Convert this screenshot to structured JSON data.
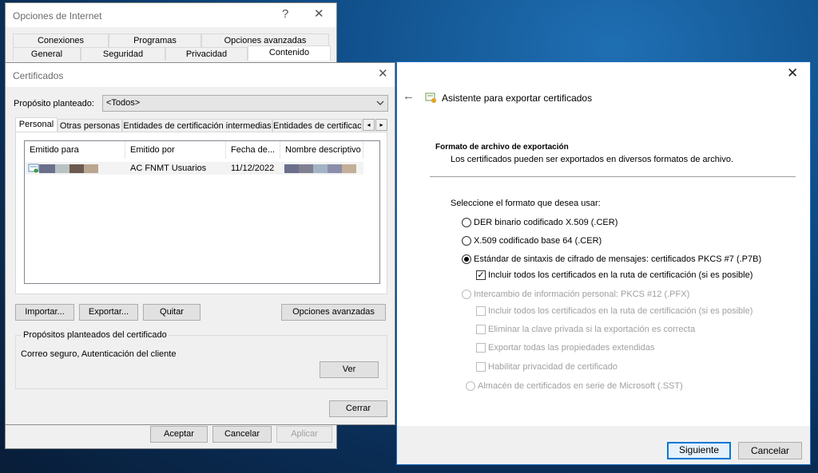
{
  "internet_options": {
    "title": "Opciones de Internet",
    "help": "?",
    "close": "✕",
    "tabs_row1": [
      "Conexiones",
      "Programas",
      "Opciones avanzadas"
    ],
    "tabs_row2": [
      "General",
      "Seguridad",
      "Privacidad",
      "Contenido"
    ],
    "buttons": {
      "accept": "Aceptar",
      "cancel": "Cancelar",
      "apply": "Aplicar"
    }
  },
  "certificates": {
    "title": "Certificados",
    "close": "✕",
    "purpose_label": "Propósito planteado:",
    "purpose_value": "<Todos>",
    "tabs": [
      "Personal",
      "Otras personas",
      "Entidades de certificación intermedias",
      "Entidades de certificac"
    ],
    "columns": [
      "Emitido para",
      "Emitido por",
      "Fecha de...",
      "Nombre descriptivo"
    ],
    "row": {
      "issued_by": "AC FNMT Usuarios",
      "date": "11/12/2022"
    },
    "buttons": {
      "import": "Importar...",
      "export": "Exportar...",
      "remove": "Quitar",
      "advanced": "Opciones avanzadas",
      "view": "Ver",
      "close": "Cerrar"
    },
    "purposes_group_title": "Propósitos planteados del certificado",
    "purposes_value": "Correo seguro, Autenticación del cliente"
  },
  "wizard": {
    "title": "Asistente para exportar certificados",
    "close": "✕",
    "back": "←",
    "section_title": "Formato de archivo de exportación",
    "section_desc": "Los certificados pueden ser exportados en diversos formatos de archivo.",
    "select_prompt": "Seleccione el formato que desea usar:",
    "options": {
      "der": "DER binario codificado X.509 (.CER)",
      "base64": "X.509 codificado base 64 (.CER)",
      "pkcs7": "Estándar de sintaxis de cifrado de mensajes: certificados PKCS #7 (.P7B)",
      "pkcs7_include": "Incluir todos los certificados en la ruta de certificación (si es posible)",
      "pfx": "Intercambio de información personal: PKCS #12 (.PFX)",
      "pfx_include": "Incluir todos los certificados en la ruta de certificación (si es posible)",
      "pfx_delete": "Eliminar la clave privada si la exportación es correcta",
      "pfx_export_props": "Exportar todas las propiedades extendidas",
      "pfx_privacy": "Habilitar privacidad de certificado",
      "sst": "Almacén de certificados en serie de Microsoft (.SST)"
    },
    "buttons": {
      "next": "Siguiente",
      "cancel": "Cancelar"
    }
  }
}
